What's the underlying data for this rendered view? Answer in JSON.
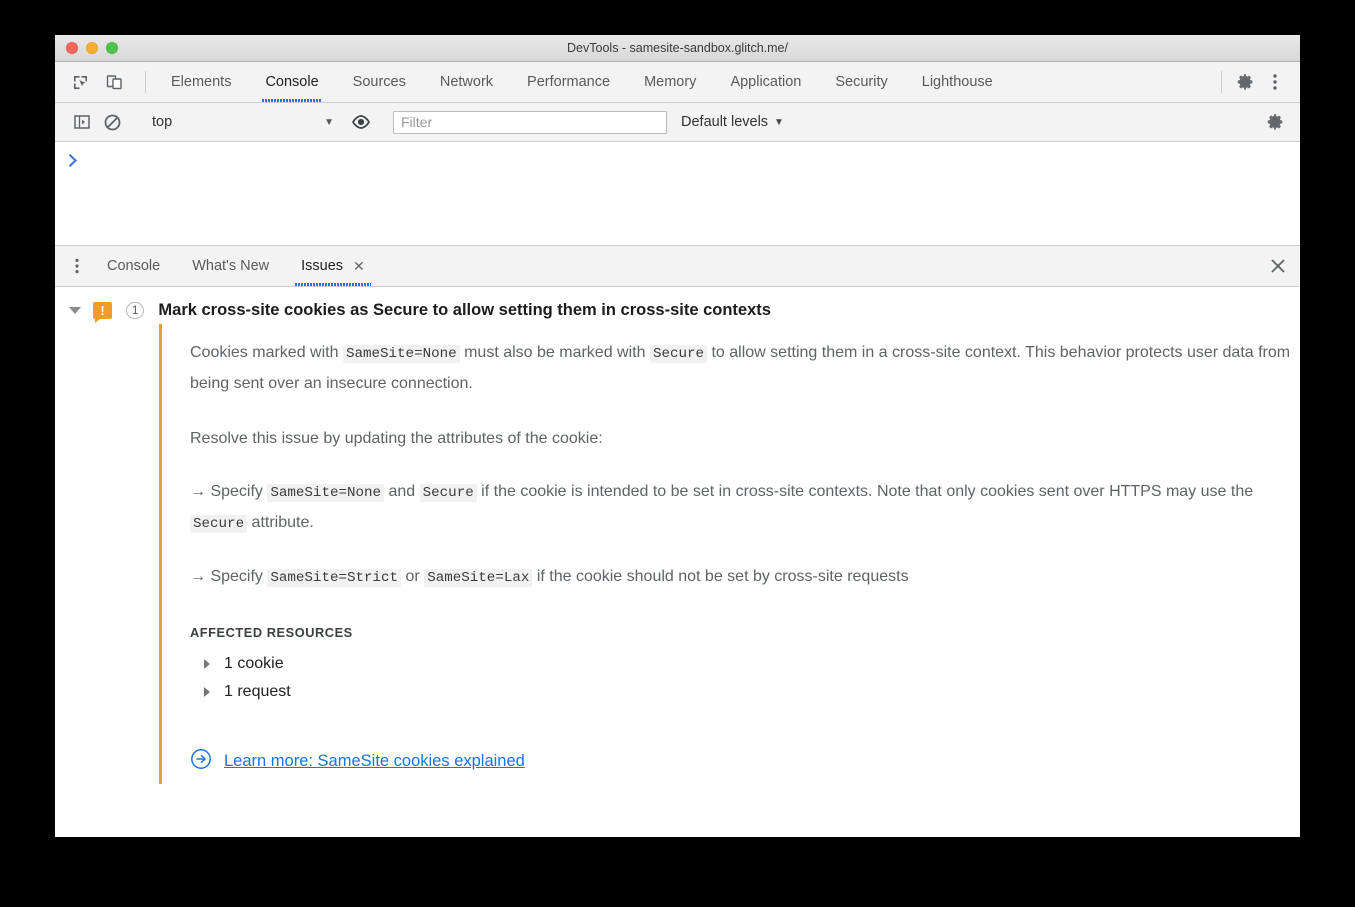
{
  "window": {
    "title": "DevTools - samesite-sandbox.glitch.me/",
    "traffic_lights": [
      "close-red",
      "minimize-yellow",
      "maximize-green"
    ]
  },
  "main_toolbar": {
    "left_icons": [
      {
        "name": "inspect-element-icon"
      },
      {
        "name": "device-toolbar-icon"
      }
    ],
    "tabs": [
      {
        "label": "Elements",
        "selected": false
      },
      {
        "label": "Console",
        "selected": true
      },
      {
        "label": "Sources",
        "selected": false
      },
      {
        "label": "Network",
        "selected": false
      },
      {
        "label": "Performance",
        "selected": false
      },
      {
        "label": "Memory",
        "selected": false
      },
      {
        "label": "Application",
        "selected": false
      },
      {
        "label": "Security",
        "selected": false
      },
      {
        "label": "Lighthouse",
        "selected": false
      }
    ],
    "right_icons": [
      {
        "name": "settings-gear-icon"
      },
      {
        "name": "more-options-kebab-icon"
      }
    ]
  },
  "console_toolbar": {
    "sidebar_toggle_icon": "console-sidebar-icon",
    "clear_icon": "clear-console-icon",
    "context": "top",
    "context_caret": "▼",
    "eye_icon": "live-expression-icon",
    "filter_placeholder": "Filter",
    "filter_value": "",
    "levels_label": "Default levels",
    "levels_caret": "▼",
    "settings_icon": "console-settings-gear-icon"
  },
  "console_body": {
    "prompt": "❯"
  },
  "drawer": {
    "kebab_icon": "drawer-more-tabs-icon",
    "tabs": [
      {
        "label": "Console",
        "selected": false,
        "closable": false
      },
      {
        "label": "What's New",
        "selected": false,
        "closable": false
      },
      {
        "label": "Issues",
        "selected": true,
        "closable": true,
        "close_glyph": "✕"
      }
    ],
    "close_drawer_glyph": "✕"
  },
  "issue": {
    "expand_state": "expanded",
    "severity_icon": "warning-bubble-icon",
    "severity_glyph": "!",
    "count": "1",
    "title": "Mark cross-site cookies as Secure to allow setting them in cross-site contexts",
    "accent_color": "#ef9c28",
    "paragraphs": [
      {
        "id": "p1",
        "parts": [
          {
            "t": "text",
            "v": "Cookies marked with "
          },
          {
            "t": "code",
            "v": "SameSite=None"
          },
          {
            "t": "text",
            "v": " must also be marked with "
          },
          {
            "t": "code",
            "v": "Secure"
          },
          {
            "t": "text",
            "v": " to allow setting them in a cross-site context. This behavior protects user data from being sent over an insecure connection."
          }
        ]
      },
      {
        "id": "p2",
        "parts": [
          {
            "t": "text",
            "v": "Resolve this issue by updating the attributes of the cookie:"
          }
        ]
      },
      {
        "id": "p3",
        "parts": [
          {
            "t": "text",
            "v": "→ Specify "
          },
          {
            "t": "code",
            "v": "SameSite=None"
          },
          {
            "t": "text",
            "v": " and "
          },
          {
            "t": "code",
            "v": "Secure"
          },
          {
            "t": "text",
            "v": " if the cookie is intended to be set in cross-site contexts. Note that only cookies sent over HTTPS may use the "
          },
          {
            "t": "code",
            "v": "Secure"
          },
          {
            "t": "text",
            "v": " attribute."
          }
        ]
      },
      {
        "id": "p4",
        "parts": [
          {
            "t": "text",
            "v": "→ Specify "
          },
          {
            "t": "code",
            "v": "SameSite=Strict"
          },
          {
            "t": "text",
            "v": " or "
          },
          {
            "t": "code",
            "v": "SameSite=Lax"
          },
          {
            "t": "text",
            "v": " if the cookie should not be set by cross-site requests"
          }
        ]
      }
    ],
    "affected_resources_label": "AFFECTED RESOURCES",
    "resources": [
      {
        "label": "1 cookie"
      },
      {
        "label": "1 request"
      }
    ],
    "learn_more": {
      "icon": "circled-arrow-right-icon",
      "label": "Learn more: SameSite cookies explained",
      "color": "#1a73e8"
    }
  }
}
